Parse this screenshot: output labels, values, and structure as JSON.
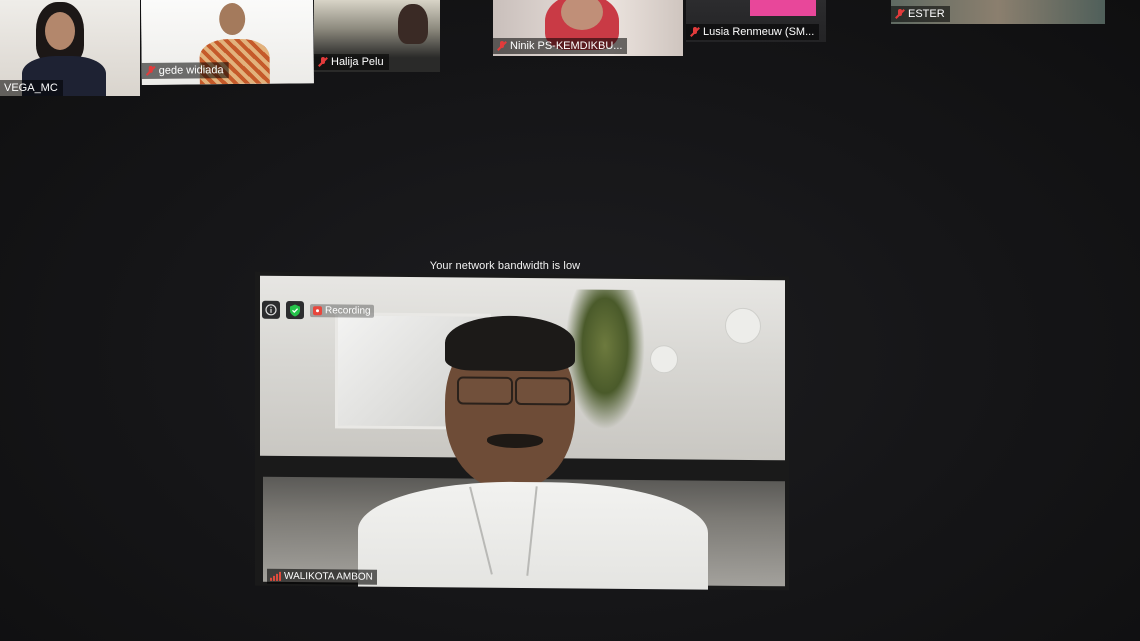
{
  "meeting": {
    "bandwidth_notice": "Your network bandwidth is low"
  },
  "gallery": [
    {
      "name": "VEGA_MC",
      "muted": false
    },
    {
      "name": "gede widiada",
      "muted": true
    },
    {
      "name": "Halija Pelu",
      "muted": true
    },
    {
      "name": "Ninik PS-KEMDIKBU...",
      "muted": true
    },
    {
      "name": "Lusia Renmeuw (SM...",
      "muted": true
    },
    {
      "name": "ESTER",
      "muted": true
    }
  ],
  "speaker": {
    "name": "WALIKOTA AMBON",
    "recording_label": "Recording",
    "info_icon": "info-icon",
    "security_icon": "shield-check-icon"
  },
  "colors": {
    "mute_red": "#e23b3b",
    "recording_red": "#e8463c",
    "shield_green": "#25c24a"
  }
}
